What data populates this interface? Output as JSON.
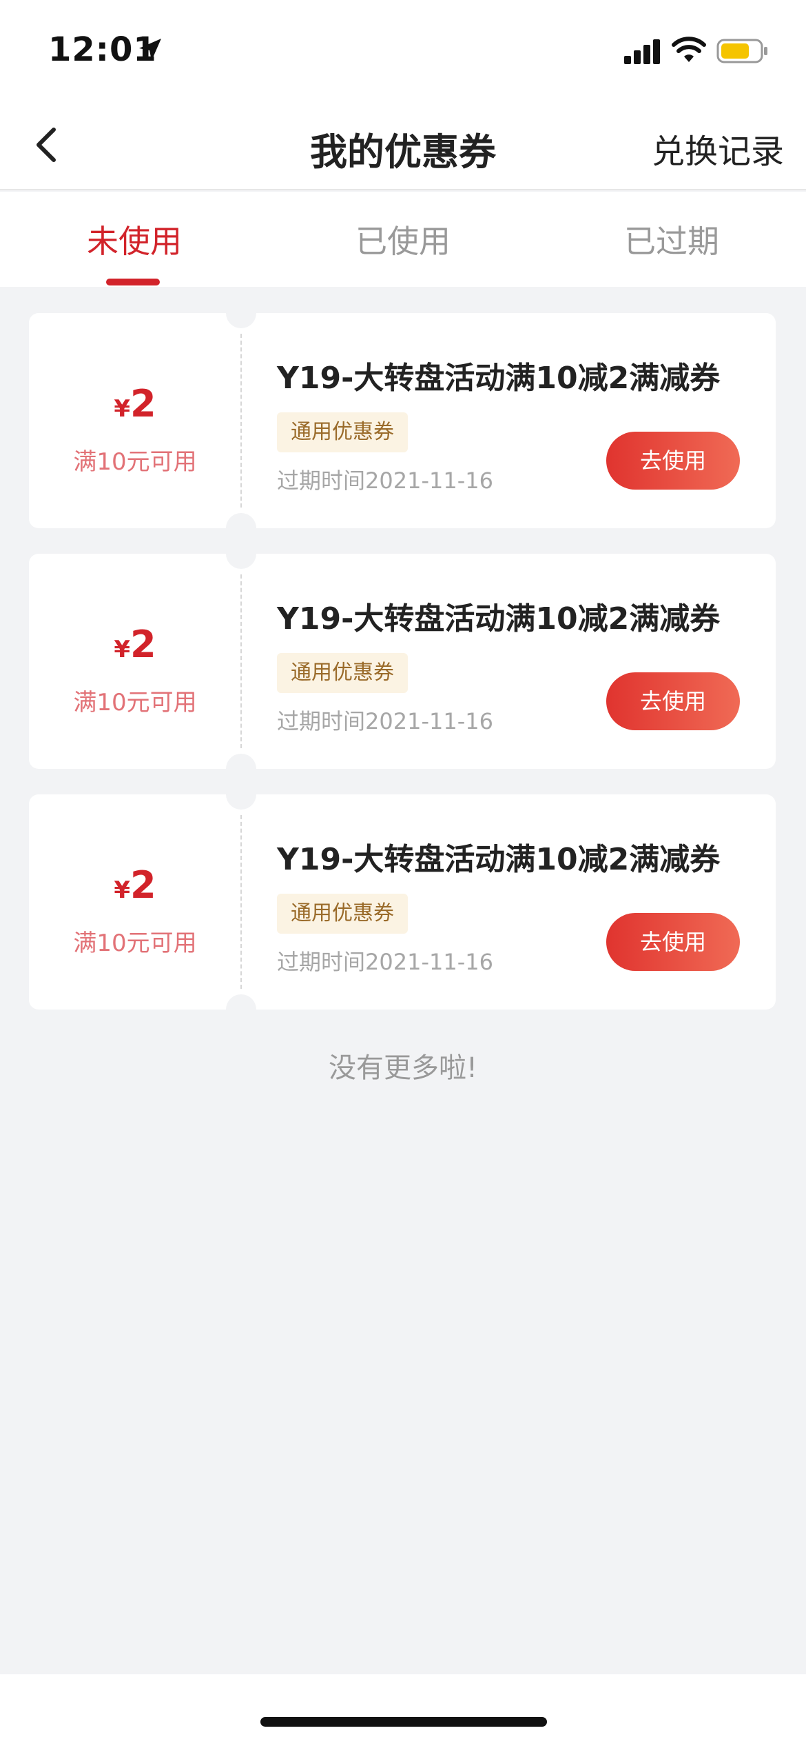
{
  "status_bar": {
    "time": "12:01",
    "icons": [
      "location-arrow-icon",
      "signal-icon",
      "wifi-icon",
      "battery-icon"
    ],
    "battery_color": "#f5c400"
  },
  "nav": {
    "title": "我的优惠券",
    "right_action": "兑换记录",
    "back_icon": "chevron-left-icon"
  },
  "tabs": [
    {
      "label": "未使用",
      "active": true
    },
    {
      "label": "已使用",
      "active": false
    },
    {
      "label": "已过期",
      "active": false
    }
  ],
  "colors": {
    "accent": "#d2232a",
    "button_start": "#e0342f",
    "button_end": "#f06a55",
    "tag_bg": "#fbf3e3"
  },
  "coupons": [
    {
      "currency": "¥",
      "amount": "2",
      "condition": "满10元可用",
      "title": "Y19-大转盘活动满10减2满减券",
      "tag": "通用优惠券",
      "expire": "过期时间2021-11-16",
      "button": "去使用"
    },
    {
      "currency": "¥",
      "amount": "2",
      "condition": "满10元可用",
      "title": "Y19-大转盘活动满10减2满减券",
      "tag": "通用优惠券",
      "expire": "过期时间2021-11-16",
      "button": "去使用"
    },
    {
      "currency": "¥",
      "amount": "2",
      "condition": "满10元可用",
      "title": "Y19-大转盘活动满10减2满减券",
      "tag": "通用优惠券",
      "expire": "过期时间2021-11-16",
      "button": "去使用"
    }
  ],
  "footer_text": "没有更多啦!"
}
